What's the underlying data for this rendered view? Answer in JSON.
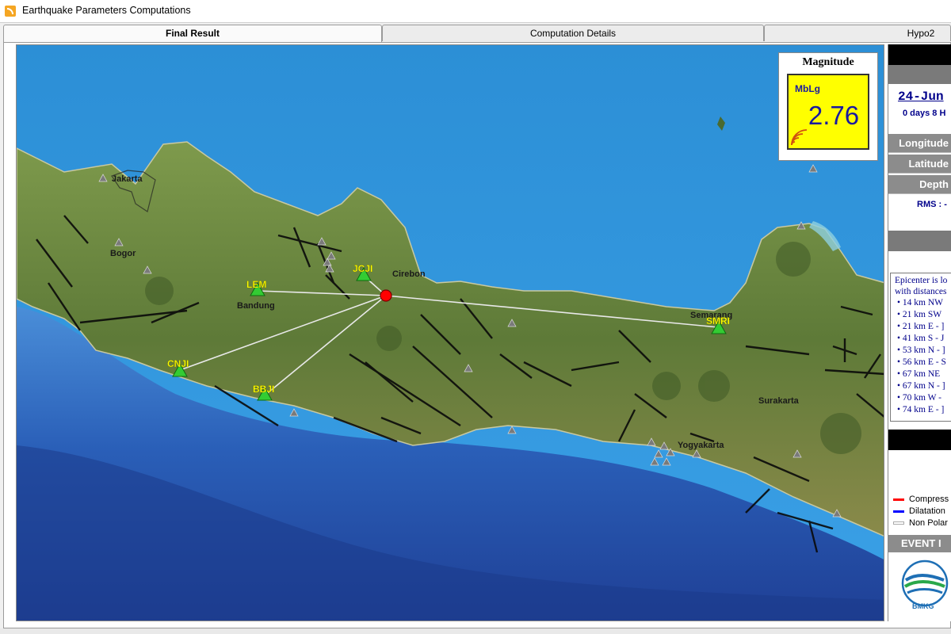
{
  "window": {
    "title": "Earthquake Parameters Computations",
    "icon": "rss-feed-icon"
  },
  "tabs": [
    {
      "label": "Final Result",
      "active": true
    },
    {
      "label": "Computation Details",
      "active": false
    },
    {
      "label": "Hypo2",
      "active": false
    }
  ],
  "magnitude": {
    "title": "Magnitude",
    "type": "MbLg",
    "value": "2.76",
    "panel_color": "#ffff00"
  },
  "map": {
    "cities": [
      "Jakarta",
      "Bogor",
      "Bandung",
      "Cirebon",
      "Semarang",
      "Surakarta",
      "Yogyakarta"
    ],
    "stations": [
      "LEM",
      "JCJI",
      "CNJI",
      "BBJI",
      "SMRI"
    ],
    "colors": {
      "station": "#33cc33",
      "station_label": "#ffff00",
      "epicenter": "#ff0000",
      "ray": "#e8e8e8"
    }
  },
  "side": {
    "date": "24-Jun",
    "duration": "0 days 8 H",
    "labels": {
      "longitude": "Longitude",
      "latitude": "Latitude",
      "depth": "Depth"
    },
    "rms": "RMS : -",
    "epicenter_heading": [
      "Epicenter is lo",
      "with distances"
    ],
    "distances": [
      "14 km NW",
      "21 km SW",
      "21 km E - ]",
      "41 km S - J",
      "53 km N - ]",
      "56 km E - S",
      "67 km NE",
      "67 km N - ]",
      "70 km W -",
      "74 km E - ]"
    ],
    "legend": [
      {
        "label": "Compress",
        "color": "#ff0000"
      },
      {
        "label": "Dilatation",
        "color": "#0000ff"
      },
      {
        "label": "Non Polar",
        "color": "#ffffff"
      }
    ],
    "event_label": "EVENT I",
    "logo_text": "BMKG"
  }
}
